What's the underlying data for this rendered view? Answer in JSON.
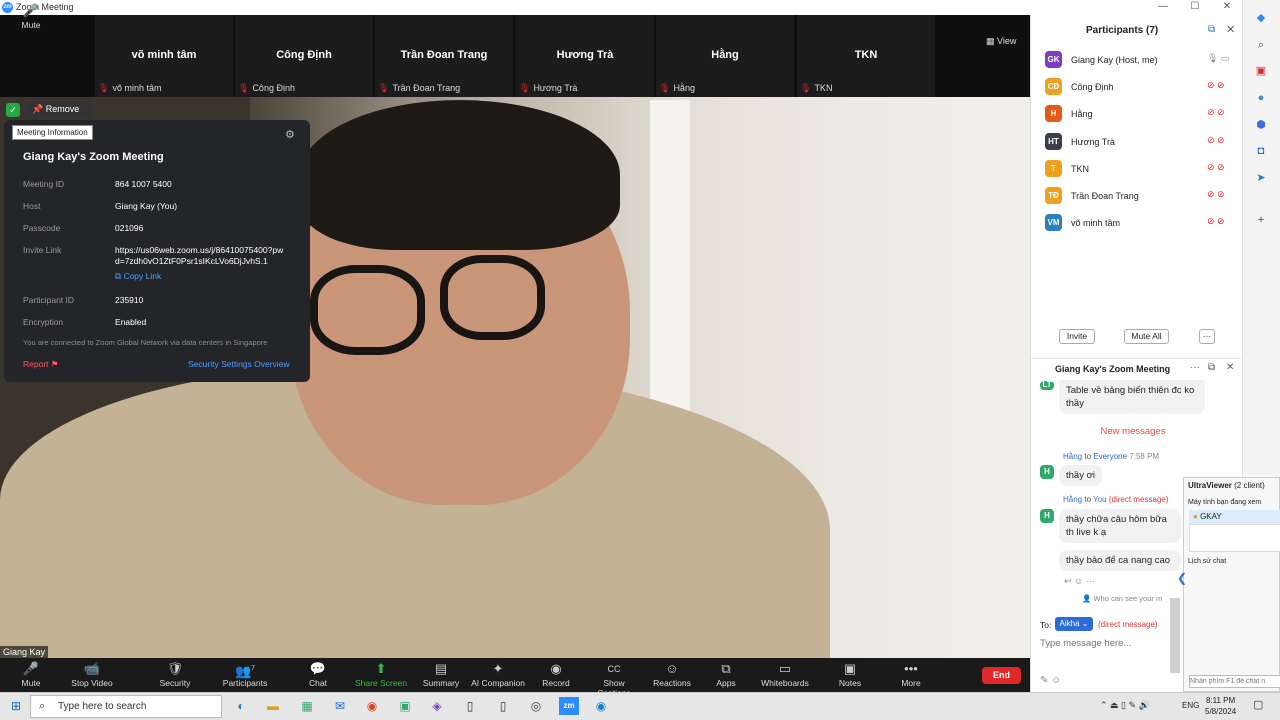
{
  "window": {
    "title": "Zoom Meeting",
    "logo_text": "zm",
    "controls": [
      "—",
      "☐",
      "✕"
    ]
  },
  "strip": {
    "view_label": "View",
    "tiles": [
      {
        "name": "võ minh tâm",
        "sub": "võ minh tâm"
      },
      {
        "name": "Công Định",
        "sub": "Công Định"
      },
      {
        "name": "Trần Đoan Trang",
        "sub": "Trần Đoan Trang"
      },
      {
        "name": "Hương Trà",
        "sub": "Hương Trà"
      },
      {
        "name": "Hằng",
        "sub": "Hằng"
      },
      {
        "name": "TKN",
        "sub": "TKN"
      }
    ]
  },
  "pin": {
    "remove_label": "Remove Pin",
    "tooltip": "Meeting Information"
  },
  "meeting_info": {
    "title": "Giang Kay's Zoom Meeting",
    "rows": [
      {
        "label": "Meeting ID",
        "value": "864 1007 5400"
      },
      {
        "label": "Host",
        "value": "Giang Kay (You)"
      },
      {
        "label": "Passcode",
        "value": "021096"
      },
      {
        "label": "Invite Link",
        "value": "https://us06web.zoom.us/j/86410075400?pwd=7zdh0vO1ZtF0Psr1sIKcLVo6DjJvhS.1"
      },
      {
        "label": "Participant ID",
        "value": "235910"
      },
      {
        "label": "Encryption",
        "value": "Enabled"
      }
    ],
    "copy_link": "Copy Link",
    "note": "You are connected to Zoom Global Network via data centers in Singapore",
    "report": "Report",
    "security_overview": "Security Settings Overview"
  },
  "video": {
    "name_tag": "Giang Kay"
  },
  "toolbar": {
    "items": [
      {
        "label": "Mute",
        "icon": "🎤"
      },
      {
        "label": "Stop Video",
        "icon": "📹"
      },
      {
        "label": "Security",
        "icon": "🛡"
      },
      {
        "label": "Participants",
        "icon": "👥",
        "badge": "7"
      },
      {
        "label": "Chat",
        "icon": "💬"
      },
      {
        "label": "Share Screen",
        "icon": "⬆"
      },
      {
        "label": "Summary",
        "icon": "▤"
      },
      {
        "label": "AI Companion",
        "icon": "✦"
      },
      {
        "label": "Record",
        "icon": "◉"
      },
      {
        "label": "Show Captions",
        "icon": "CC"
      },
      {
        "label": "Reactions",
        "icon": "☺"
      },
      {
        "label": "Apps",
        "icon": "⧉"
      },
      {
        "label": "Whiteboards",
        "icon": "▭"
      },
      {
        "label": "Notes",
        "icon": "▣"
      },
      {
        "label": "More",
        "icon": "•••"
      }
    ],
    "end_label": "End",
    "share_color": "#2ebd4e"
  },
  "participants": {
    "title": "Participants (7)",
    "list": [
      {
        "initials": "GK",
        "name": "Giang Kay (Host, me)",
        "color": "#7a3fbf"
      },
      {
        "initials": "CĐ",
        "name": "Công Định",
        "color": "#f0a020"
      },
      {
        "initials": "H",
        "name": "Hằng",
        "color": "#e05a18"
      },
      {
        "initials": "HT",
        "name": "Hương Trà",
        "color": "#3a3f4a"
      },
      {
        "initials": "T",
        "name": "TKN",
        "color": "#f0a020"
      },
      {
        "initials": "TĐ",
        "name": "Trần Đoan Trang",
        "color": "#f0a020"
      },
      {
        "initials": "VM",
        "name": "võ minh tâm",
        "color": "#2a7fc0"
      }
    ],
    "invite_label": "Invite",
    "mute_all_label": "Mute All",
    "more_label": "···"
  },
  "chat": {
    "title": "Giang Kay's Zoom Meeting",
    "prev_message": "Table về bảng biến thiên đc ko thầy",
    "prev_avatar": "LT",
    "new_messages": "New messages",
    "msg1_sender": "Hằng",
    "msg1_to": "to",
    "msg1_target": "Everyone",
    "msg1_time": "7:58 PM",
    "msg1_text": "thầy ơi",
    "msg2_sender": "Hằng",
    "msg2_to": "to",
    "msg2_target": "You",
    "msg2_direct": "(direct message)",
    "msg2_text": "thầy chữa câu hôm bữa th live k ạ",
    "msg3_text": "thầy bảo để ca nang cao",
    "avatar_initial": "H",
    "who_can_see": "Who can see your m",
    "to_label": "To:",
    "to_chip": "Aikha",
    "to_direct": "(direct message)",
    "input_placeholder": "Type message here..."
  },
  "ultraviewer": {
    "title": "UltraViewer",
    "clients": "(2 client)",
    "watching": "Máy tính bạn đang xem",
    "entry": "GKAY",
    "history": "Lịch sử chat",
    "input_placeholder": "Nhấn phím F1 để chat n"
  },
  "taskbar": {
    "search_placeholder": "Type here to search",
    "language": "ENG",
    "time": "8:11 PM",
    "date": "5/8/2024"
  }
}
